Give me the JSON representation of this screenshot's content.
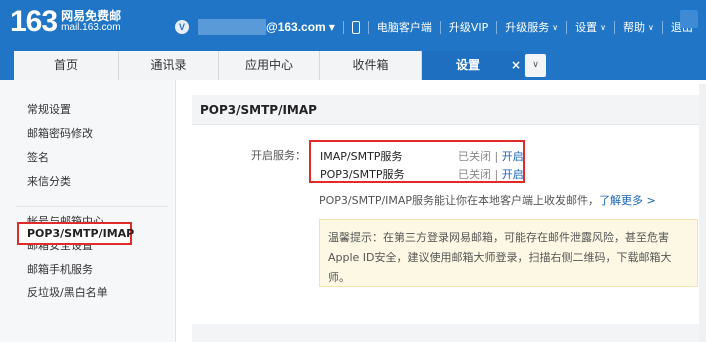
{
  "header": {
    "logo_number": "163",
    "logo_cn": "网易免费邮",
    "logo_url": "mail.163.com",
    "vip_badge": "V",
    "email_suffix": "@163.com",
    "links": [
      "电脑客户端",
      "升级VIP",
      "升级服务",
      "设置",
      "帮助",
      "退出"
    ]
  },
  "tabs": [
    {
      "label": "首页"
    },
    {
      "label": "通讯录"
    },
    {
      "label": "应用中心"
    },
    {
      "label": "收件箱"
    },
    {
      "label": "设置",
      "active": true
    }
  ],
  "tab_close": "×",
  "sidebar": {
    "items": [
      "常规设置",
      "邮箱密码修改",
      "签名",
      "来信分类",
      "帐号与邮箱中心",
      "邮箱安全设置",
      "邮箱手机服务",
      "反垃圾/黑白名单"
    ],
    "active": "POP3/SMTP/IMAP"
  },
  "main": {
    "title": "POP3/SMTP/IMAP",
    "service_label": "开启服务：",
    "services": [
      {
        "name": "IMAP/SMTP服务",
        "status": "已关闭",
        "action": "开启"
      },
      {
        "name": "POP3/SMTP服务",
        "status": "已关闭",
        "action": "开启"
      }
    ],
    "desc": "POP3/SMTP/IMAP服务能让你在本地客户端上收发邮件，",
    "desc_link": "了解更多 >",
    "tip": "温馨提示：在第三方登录网易邮箱，可能存在邮件泄露风险，甚至危害Apple ID安全，建议使用邮箱大师登录，扫描右侧二维码，下载邮箱大师。"
  },
  "colors": {
    "brand": "#2175c6",
    "highlight": "#e02b2b",
    "link": "#1a64b8"
  }
}
